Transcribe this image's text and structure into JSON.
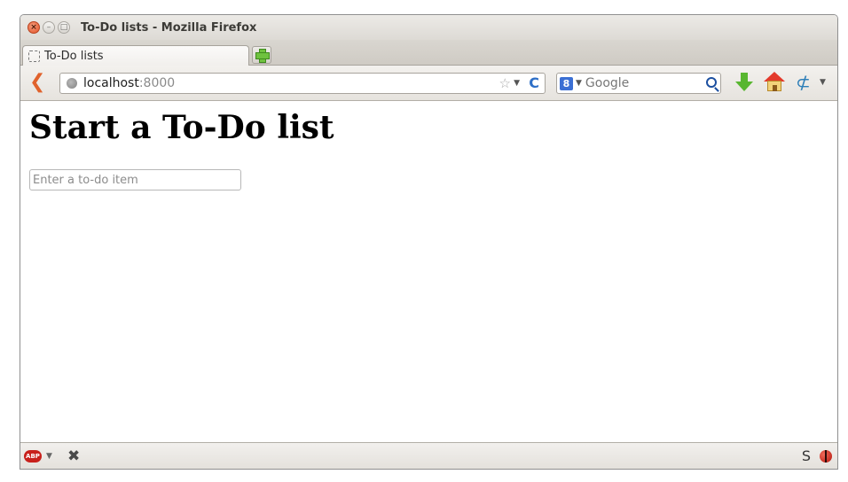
{
  "window": {
    "title": "To-Do lists - Mozilla Firefox",
    "controls": {
      "close_glyph": "×",
      "minimize_glyph": "–",
      "maximize_glyph": "□"
    }
  },
  "tabs": [
    {
      "label": "To-Do lists",
      "active": true
    }
  ],
  "new_tab_icon": "plus-icon",
  "navbar": {
    "back_glyph": "❮",
    "url_host": "localhost",
    "url_port": ":8000",
    "bookmark_glyph": "☆",
    "dropdown_glyph": "▼",
    "reload_glyph": "C",
    "search_engine_glyph": "8",
    "search_placeholder": "Google",
    "network_glyph": "⊄"
  },
  "page": {
    "heading": "Start a To-Do list",
    "input_placeholder": "Enter a to-do item"
  },
  "addon_bar": {
    "adblock_label": "ABP",
    "dropdown_glyph": "▼",
    "close_glyph": "✖",
    "s_glyph": "S"
  },
  "colors": {
    "accent_back": "#e0622c",
    "download_green": "#58b630",
    "home_red": "#e33a2b",
    "reload_blue": "#2e6fc7"
  }
}
